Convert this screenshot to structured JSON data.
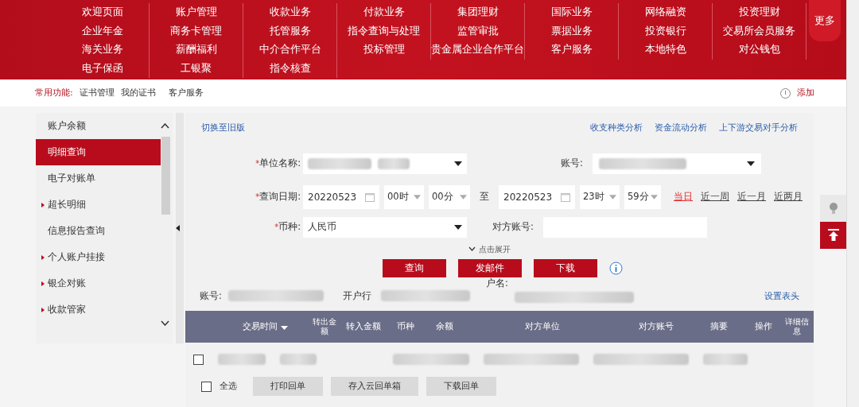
{
  "nav": {
    "rows": [
      [
        "欢迎页面",
        "账户管理",
        "收款业务",
        "付款业务",
        "集团理财",
        "国际业务",
        "网络融资",
        "投资理财"
      ],
      [
        "企业年金",
        "商务卡管理",
        "托管服务",
        "指令查询与处理",
        "监管审批",
        "票据业务",
        "投资银行",
        "交易所会员服务"
      ],
      [
        "海关业务",
        "薪酬福利",
        "中介合作平台",
        "投标管理",
        "贵金属企业合作平台",
        "客户服务",
        "本地特色",
        "对公钱包"
      ],
      [
        "电子保函",
        "工银聚",
        "指令核查"
      ]
    ],
    "more": "更多"
  },
  "quickbar": {
    "label": "常用功能:",
    "items": [
      "证书管理",
      "我的证书",
      "客户服务"
    ],
    "add": "添加"
  },
  "sidebar": {
    "items": [
      {
        "label": "账户余额",
        "selected": false,
        "expandable": false
      },
      {
        "label": "明细查询",
        "selected": true,
        "expandable": false
      },
      {
        "label": "电子对账单",
        "selected": false,
        "expandable": false
      },
      {
        "label": "超长明细",
        "selected": false,
        "expandable": true
      },
      {
        "label": "信息报告查询",
        "selected": false,
        "expandable": false
      },
      {
        "label": "个人账户挂接",
        "selected": false,
        "expandable": true
      },
      {
        "label": "银企对账",
        "selected": false,
        "expandable": true
      },
      {
        "label": "收款管家",
        "selected": false,
        "expandable": true
      }
    ]
  },
  "content": {
    "switch_link": "切换至旧版",
    "analysis_links": [
      "收支种类分析",
      "资金流动分析",
      "上下游交易对手分析"
    ],
    "form": {
      "required_mark": "*",
      "unit_label": "单位名称:",
      "account_label": "账号:",
      "date_label": "查询日期:",
      "start_date": "20220523",
      "start_hour": "00时",
      "start_minute": "00分",
      "to": "至",
      "end_date": "20220523",
      "end_hour": "23时",
      "end_minute": "59分",
      "ranges": [
        {
          "label": "当日",
          "selected": true
        },
        {
          "label": "近一周",
          "selected": false
        },
        {
          "label": "近一月",
          "selected": false
        },
        {
          "label": "近两月",
          "selected": false
        }
      ],
      "currency_label": "币种:",
      "currency": "人民币",
      "counter_account_label": "对方账号:",
      "expand": "点击展开"
    },
    "buttons": [
      "查询",
      "发邮件",
      "下载"
    ],
    "info": {
      "account_label": "账号:",
      "bank_label": "开户行",
      "name_label": "户名:",
      "set_header": "设置表头"
    },
    "table": {
      "columns": [
        "交易时间",
        "转出金额",
        "转入金额",
        "币种",
        "余额",
        "对方单位",
        "对方账号",
        "摘要",
        "操作",
        "详细信息"
      ],
      "rows": [
        {
          "checked": false
        }
      ]
    },
    "footer": {
      "select_all": "全选",
      "select_all_checked": false,
      "buttons": [
        "打印回单",
        "存入云回单箱",
        "下载回单"
      ]
    }
  }
}
